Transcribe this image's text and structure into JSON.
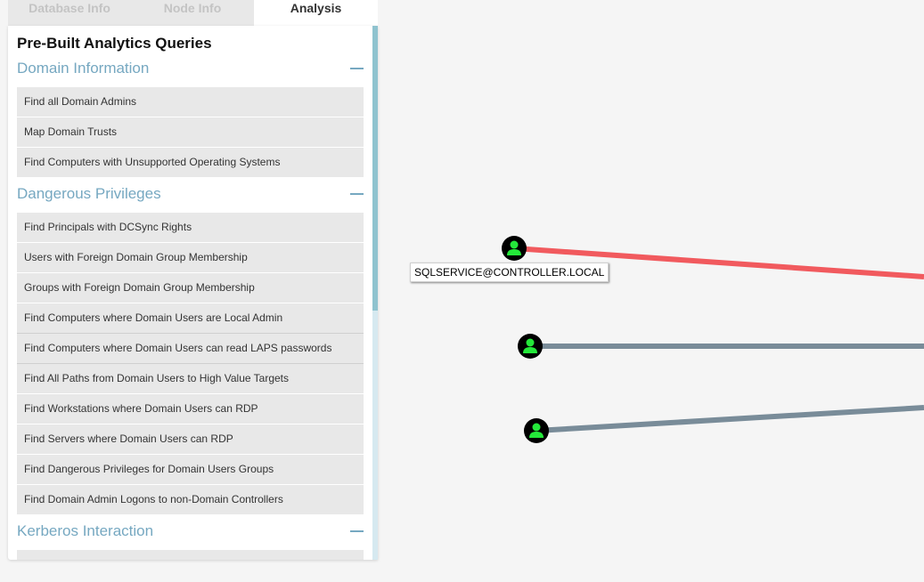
{
  "tabs": [
    {
      "label": "Database Info",
      "active": false
    },
    {
      "label": "Node Info",
      "active": false
    },
    {
      "label": "Analysis",
      "active": true
    }
  ],
  "panel": {
    "title": "Pre-Built Analytics Queries",
    "sections": [
      {
        "label": "Domain Information",
        "icon": "collapse-minus-icon",
        "queries": [
          "Find all Domain Admins",
          "Map Domain Trusts",
          "Find Computers with Unsupported Operating Systems"
        ]
      },
      {
        "label": "Dangerous Privileges",
        "icon": "collapse-minus-icon",
        "queries": [
          "Find Principals with DCSync Rights",
          "Users with Foreign Domain Group Membership",
          "Groups with Foreign Domain Group Membership",
          "Find Computers where Domain Users are Local Admin",
          "Find Computers where Domain Users can read LAPS passwords",
          "Find All Paths from Domain Users to High Value Targets",
          "Find Workstations where Domain Users can RDP",
          "Find Servers where Domain Users can RDP",
          "Find Dangerous Privileges for Domain Users Groups",
          "Find Domain Admin Logons to non-Domain Controllers"
        ]
      },
      {
        "label": "Kerberos Interaction",
        "icon": "collapse-minus-icon",
        "queries": [
          ""
        ]
      }
    ]
  },
  "graph": {
    "node_label": "SQLSERVICE@CONTROLLER.LOCAL",
    "node_icon": "user-icon",
    "colors": {
      "highlight_edge": "#f15a5e",
      "edge": "#798c99",
      "node_fill": "#000000",
      "node_glyph": "#24e83a"
    }
  },
  "colors": {
    "section_header": "#76a8c1",
    "query_bg": "#e8e8e8",
    "tab_inactive_bg": "#e8e8e8",
    "tab_inactive_text": "#c4c4c4"
  }
}
